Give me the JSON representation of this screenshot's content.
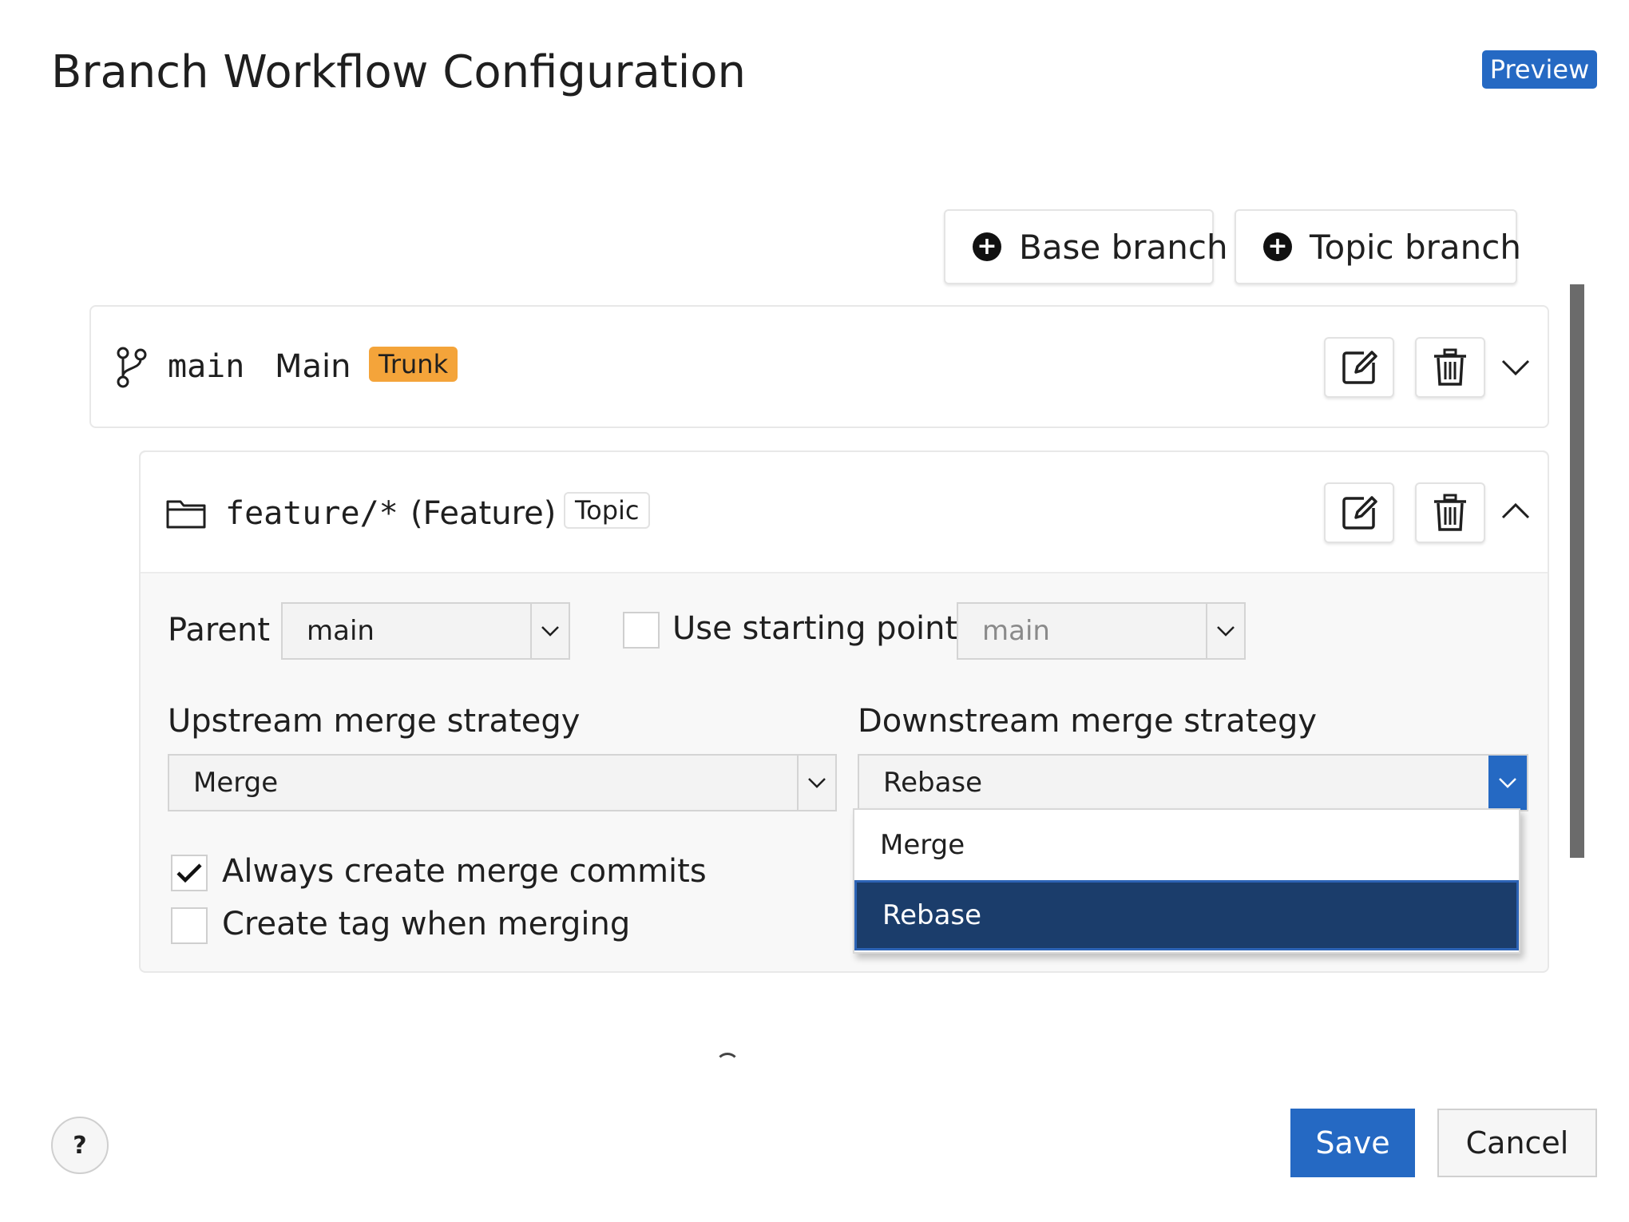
{
  "dialog": {
    "title": "Branch Workflow Configuration",
    "preview_badge": "Preview"
  },
  "toolbar": {
    "base_branch_label": "Base branch",
    "topic_branch_label": "Topic branch"
  },
  "branches": [
    {
      "pattern": "main",
      "name": "Main",
      "badge": "Trunk",
      "icon": "git-branch-icon",
      "expanded": false
    },
    {
      "pattern": "feature/*",
      "name": "(Feature)",
      "badge": "Topic",
      "icon": "folder-icon",
      "expanded": true,
      "settings": {
        "parent_label": "Parent",
        "parent_value": "main",
        "use_starting_point_label": "Use starting point",
        "use_starting_point_checked": false,
        "starting_point_value": "main",
        "upstream_label": "Upstream merge strategy",
        "upstream_value": "Merge",
        "downstream_label": "Downstream merge strategy",
        "downstream_value": "Rebase",
        "always_merge_commits_label": "Always create merge commits",
        "always_merge_commits_checked": true,
        "create_tag_label": "Create tag when merging",
        "create_tag_checked": false
      }
    }
  ],
  "downstream_dropdown": {
    "options": [
      "Merge",
      "Rebase"
    ],
    "selected": "Rebase"
  },
  "footer": {
    "help_label": "?",
    "save_label": "Save",
    "cancel_label": "Cancel"
  },
  "colors": {
    "accent": "#2569c3",
    "trunk_badge": "#f4a43a",
    "selected_option": "#1b3d6b"
  }
}
